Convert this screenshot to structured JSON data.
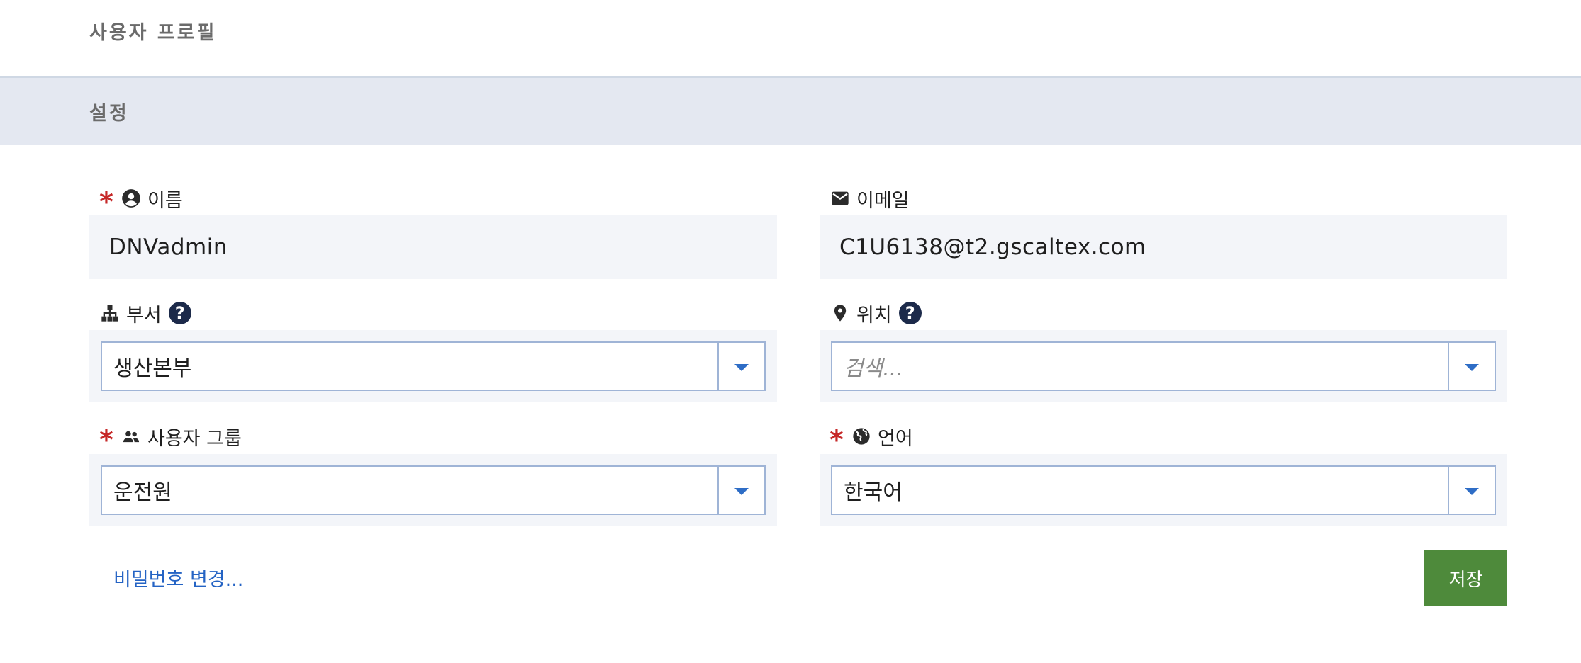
{
  "header": {
    "title": "사용자 프로필"
  },
  "section": {
    "title": "설정"
  },
  "form": {
    "name": {
      "label": "이름",
      "value": "DNVadmin",
      "required": true,
      "icon": "user-circle-icon"
    },
    "email": {
      "label": "이메일",
      "value": "C1U6138@t2.gscaltex.com",
      "required": false,
      "icon": "envelope-icon"
    },
    "department": {
      "label": "부서",
      "value": "생산본부",
      "icon": "org-chart-icon",
      "help": "?"
    },
    "location": {
      "label": "위치",
      "placeholder": "검색...",
      "icon": "map-pin-icon",
      "help": "?"
    },
    "user_group": {
      "label": "사용자 그룹",
      "value": "운전원",
      "required": true,
      "icon": "users-icon"
    },
    "language": {
      "label": "언어",
      "value": "한국어",
      "required": true,
      "icon": "globe-icon"
    }
  },
  "required_mark": "*",
  "actions": {
    "change_password": "비밀번호 변경...",
    "save": "저장"
  },
  "colors": {
    "required": "#c62828",
    "link": "#2463c4",
    "save_button": "#4e8a3b",
    "section_bar": "#e4e8f1",
    "field_background": "#f3f5f9",
    "help_icon": "#1c2a4a",
    "dropdown_arrow": "#2e6dc6"
  }
}
